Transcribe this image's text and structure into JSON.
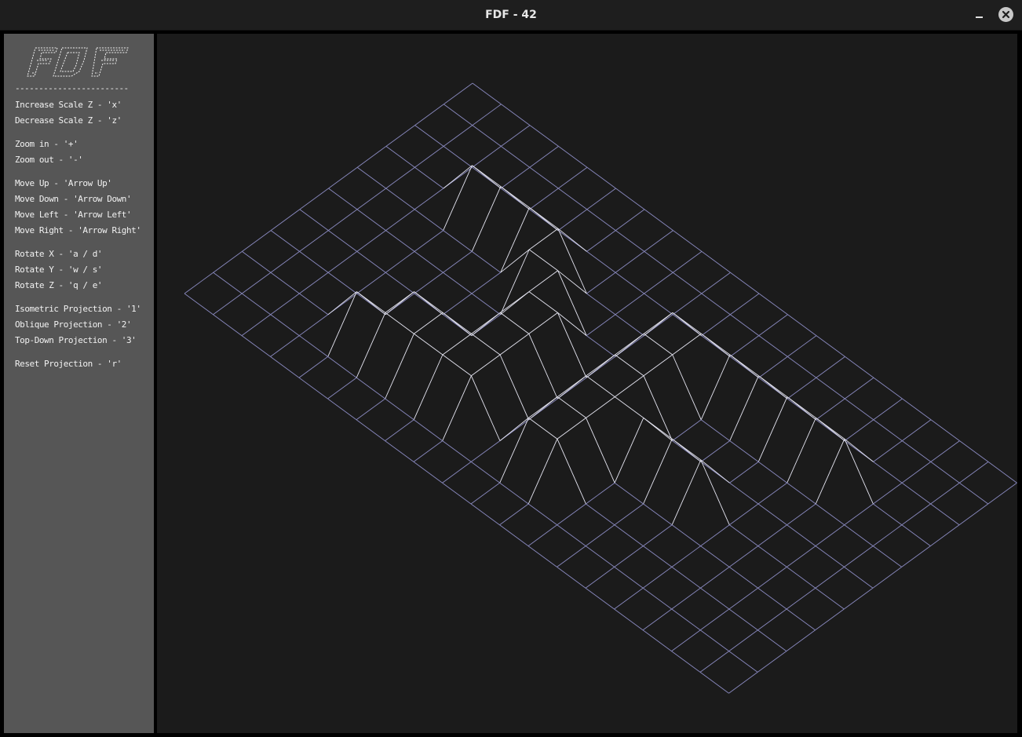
{
  "window": {
    "title": "FDF - 42"
  },
  "titlebar_buttons": {
    "minimize_icon": "minimize-icon",
    "close_icon": "close-icon"
  },
  "sidebar": {
    "logo_text": "FDF",
    "divider": "------------------------",
    "help_items": [
      "Increase Scale Z - 'x'",
      "Decrease Scale Z - 'z'",
      "Zoom in - '+'",
      "Zoom out - '-'",
      "Move Up - 'Arrow Up'",
      "Move Down - 'Arrow Down'",
      "Move Left - 'Arrow Left'",
      "Move Right - 'Arrow Right'",
      "Rotate X - 'a / d'",
      "Rotate Y - 'w / s'",
      "Rotate Z - 'q / e'",
      "Isometric Projection - '1'",
      "Oblique Projection - '2'",
      "Top-Down Projection - '3'",
      "Reset Projection - 'r'"
    ]
  },
  "colors": {
    "sidebar_bg": "#565656",
    "viewport_bg": "#1b1b1b",
    "wire_low": "#8a8ac0",
    "wire_high": "#e6e6f2"
  },
  "map": {
    "heights": [
      [
        0,
        0,
        0,
        0,
        0,
        0,
        0,
        0,
        0,
        0,
        0,
        0,
        0,
        0,
        0,
        0,
        0,
        0,
        0,
        0
      ],
      [
        0,
        0,
        0,
        0,
        0,
        0,
        0,
        0,
        0,
        0,
        0,
        0,
        0,
        0,
        0,
        0,
        0,
        0,
        0,
        0
      ],
      [
        0,
        0,
        0,
        0,
        0,
        0,
        0,
        0,
        0,
        0,
        0,
        0,
        0,
        0,
        0,
        0,
        0,
        0,
        0,
        0
      ],
      [
        0,
        0,
        0,
        10,
        10,
        10,
        10,
        0,
        0,
        0,
        10,
        10,
        10,
        10,
        10,
        10,
        10,
        0,
        0,
        0
      ],
      [
        0,
        0,
        0,
        0,
        0,
        0,
        10,
        10,
        0,
        0,
        10,
        10,
        0,
        0,
        0,
        0,
        0,
        0,
        0,
        0
      ],
      [
        0,
        0,
        0,
        0,
        0,
        0,
        0,
        10,
        10,
        0,
        10,
        10,
        0,
        0,
        0,
        0,
        0,
        0,
        0,
        0
      ],
      [
        0,
        0,
        0,
        0,
        0,
        0,
        0,
        10,
        10,
        0,
        10,
        10,
        10,
        10,
        10,
        0,
        0,
        0,
        0,
        0
      ],
      [
        0,
        0,
        0,
        0,
        0,
        10,
        10,
        10,
        10,
        0,
        10,
        10,
        0,
        0,
        0,
        0,
        0,
        0,
        0,
        0
      ],
      [
        0,
        0,
        0,
        0,
        10,
        10,
        10,
        10,
        10,
        0,
        10,
        10,
        0,
        0,
        0,
        0,
        0,
        0,
        0,
        0
      ],
      [
        0,
        0,
        0,
        0,
        0,
        0,
        0,
        0,
        0,
        0,
        0,
        0,
        0,
        0,
        0,
        0,
        0,
        0,
        0,
        0
      ],
      [
        0,
        0,
        0,
        0,
        0,
        0,
        0,
        0,
        0,
        0,
        0,
        0,
        0,
        0,
        0,
        0,
        0,
        0,
        0,
        0
      ]
    ]
  }
}
